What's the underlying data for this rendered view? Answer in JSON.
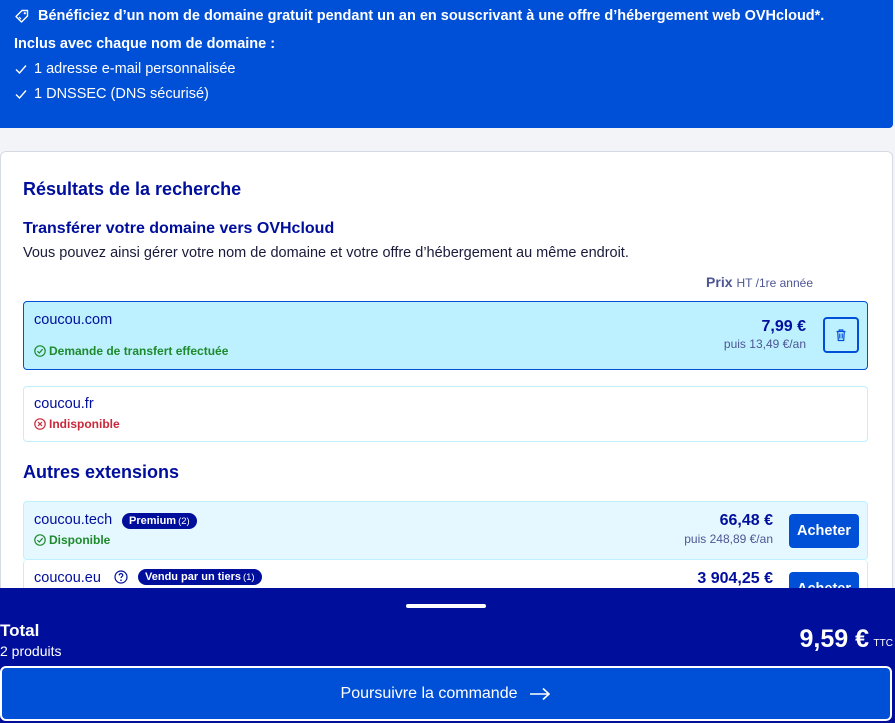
{
  "promo": {
    "headline": "Bénéficiez d’un nom de domaine gratuit pendant un an en souscrivant à une offre d’hébergement web OVHcloud*.",
    "included_title": "Inclus avec chaque nom de domaine :",
    "items": [
      "1 adresse e-mail personnalisée",
      "1 DNSSEC (DNS sécurisé)"
    ]
  },
  "results": {
    "title": "Résultats de la recherche",
    "transfer_title": "Transférer votre domaine vers OVHcloud",
    "transfer_desc": "Vous pouvez ainsi gérer votre nom de domaine et votre offre d’hébergement au même endroit.",
    "price_label": "Prix",
    "price_unit": "HT /1re année",
    "domains": [
      {
        "name": "coucou.com",
        "status": "Demande de transfert effectuée",
        "price": "7,99 €",
        "after": "puis 13,49 €/an"
      },
      {
        "name": "coucou.fr",
        "status": "Indisponible"
      }
    ]
  },
  "other": {
    "title": "Autres extensions",
    "domains": [
      {
        "name": "coucou.tech",
        "badge": "Premium",
        "badge_count": "(2)",
        "status": "Disponible",
        "price": "66,48 €",
        "after": "puis 248,89 €/an",
        "button": "Acheter"
      },
      {
        "name": "coucou.eu",
        "badge": "Vendu par un tiers",
        "badge_count": "(1)",
        "price": "3 904,25 €",
        "button": "Acheter"
      }
    ]
  },
  "footer": {
    "total_label": "Total",
    "total_count": "2 produits",
    "total_amount": "9,59 €",
    "tax_label": "TTC",
    "continue_label": "Poursuivre la commande"
  },
  "colors": {
    "accent": "#0050d7",
    "navy": "#000e9c",
    "highlight": "#bef1ff"
  }
}
